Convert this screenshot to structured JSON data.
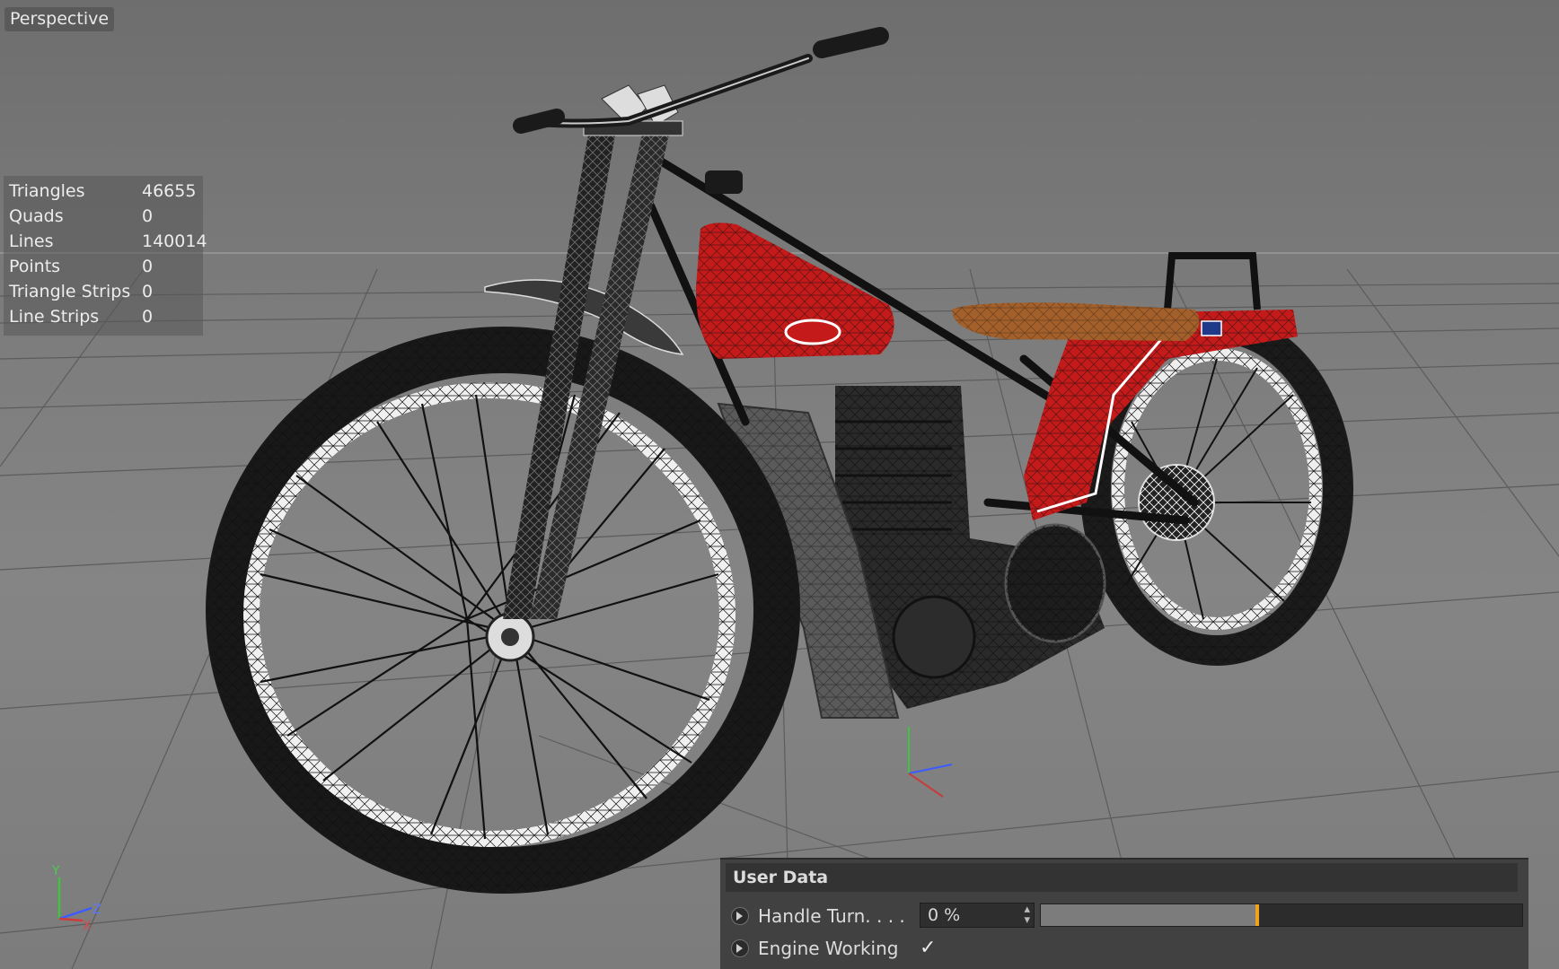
{
  "viewport": {
    "name": "Perspective",
    "stats": [
      {
        "label": "Triangles",
        "value": "46655"
      },
      {
        "label": "Quads",
        "value": "0"
      },
      {
        "label": "Lines",
        "value": "140014"
      },
      {
        "label": "Points",
        "value": "0"
      },
      {
        "label": "Triangle Strips",
        "value": "0"
      },
      {
        "label": "Line Strips",
        "value": "0"
      }
    ],
    "axes": {
      "y": "Y",
      "z": "Z",
      "x": "X"
    }
  },
  "user_data": {
    "title": "User Data",
    "handle_turn": {
      "label": "Handle Turn. . . .",
      "value": "0 %",
      "slider_fraction": 0.45
    },
    "engine_working": {
      "label": "Engine Working",
      "checked": true,
      "check_glyph": "✓"
    }
  },
  "colors": {
    "tank_red": "#c41a1a",
    "seat_brown": "#a4602a",
    "slider_accent": "#f0a21a",
    "panel_bg": "#414141"
  },
  "icons": [
    "animate-icon",
    "checkbox-icon",
    "spinner-icon",
    "world-axis-icon"
  ]
}
